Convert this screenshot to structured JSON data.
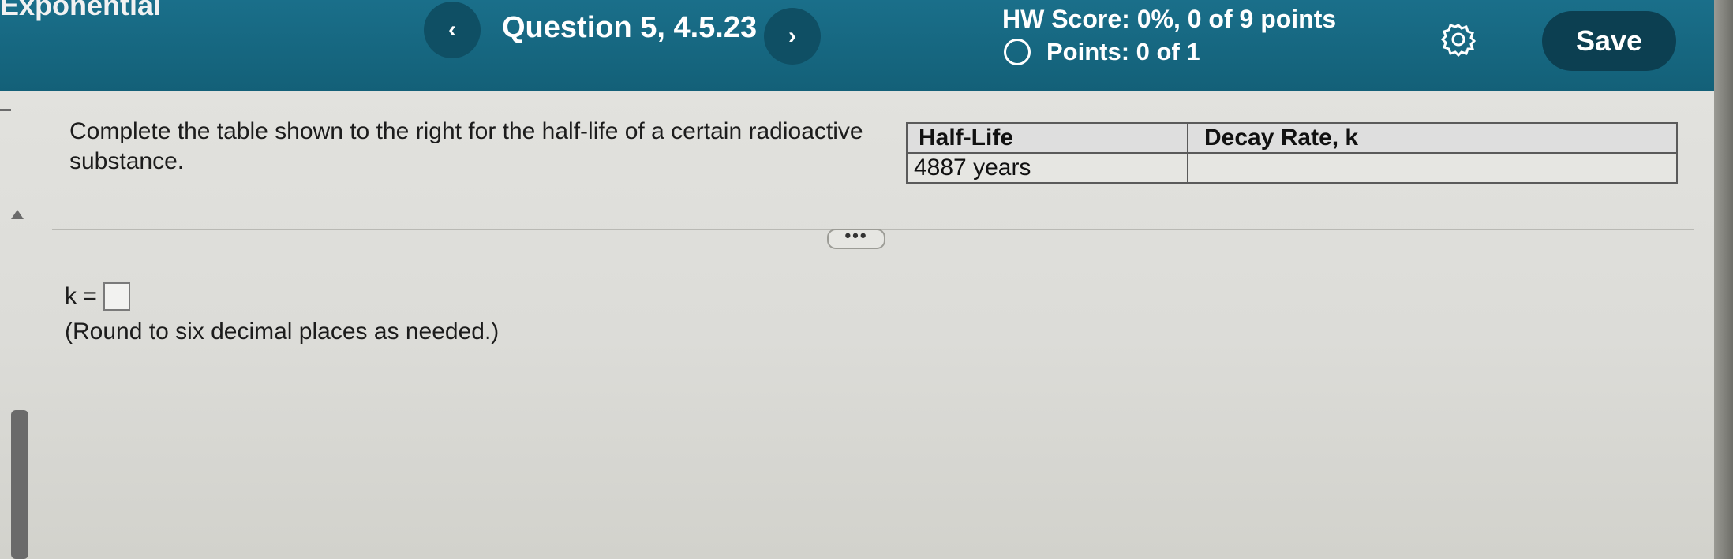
{
  "header": {
    "course_title": "Exponential",
    "prev_label": "‹",
    "question_title": "Question 5, 4.5.23",
    "next_label": "›",
    "hw_score": "HW Score: 0%, 0 of 9 points",
    "points": "Points: 0 of 1",
    "save_label": "Save",
    "settings_icon": "gear-icon"
  },
  "question": {
    "prompt": "Complete the table shown to the right for the half-life of a certain radioactive substance.",
    "table": {
      "headers": [
        "Half-Life",
        "Decay Rate, k"
      ],
      "rows": [
        [
          "4887 years",
          ""
        ]
      ]
    },
    "more_label": "•••",
    "answer_label": "k =",
    "answer_value": "",
    "instruction": "(Round to six decimal places as needed.)"
  },
  "colors": {
    "header_bg": "#136078",
    "save_bg": "#0c3f51",
    "page_bg": "#dcdcd8"
  }
}
